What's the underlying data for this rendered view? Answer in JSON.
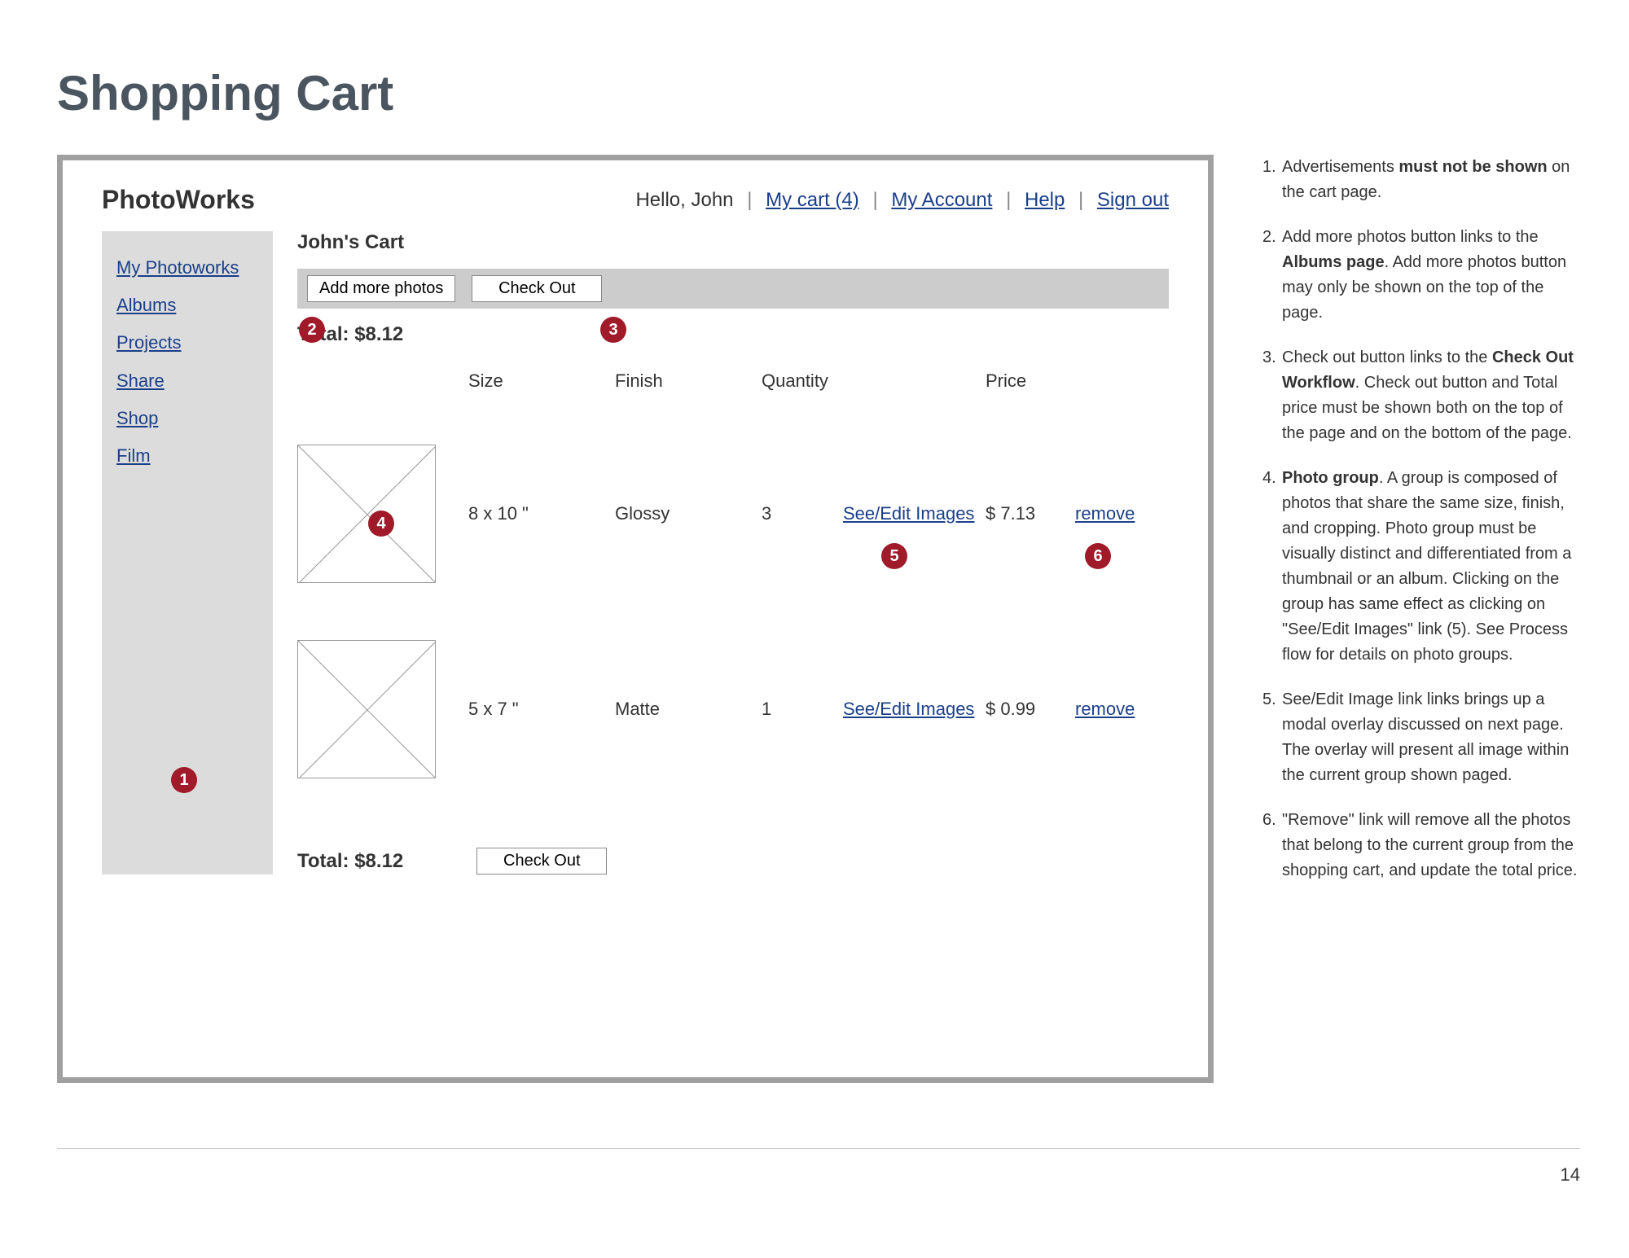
{
  "page_title": "Shopping Cart",
  "page_number": "14",
  "logo": "PhotoWorks",
  "greeting": "Hello, John",
  "top_links": {
    "cart": "My cart (4)",
    "account": "My Account",
    "help": "Help",
    "signout": "Sign out"
  },
  "sidebar": [
    "My Photoworks",
    "Albums",
    "Projects",
    "Share",
    "Shop",
    "Film"
  ],
  "cart_title": "John's Cart",
  "buttons": {
    "add_photos": "Add more photos",
    "checkout": "Check Out"
  },
  "total_label": "Total: $8.12",
  "headers": {
    "size": "Size",
    "finish": "Finish",
    "quantity": "Quantity",
    "price": "Price"
  },
  "see_edit_label": "See/Edit Images",
  "remove_label": "remove",
  "rows": [
    {
      "size": "8 x 10 \"",
      "finish": "Glossy",
      "qty": "3",
      "price": "$ 7.13"
    },
    {
      "size": "5 x 7 \"",
      "finish": "Matte",
      "qty": "1",
      "price": "$ 0.99"
    }
  ],
  "annotations": {
    "n1": {
      "num": "1.",
      "pre": "Advertisements ",
      "bold": "must not be shown",
      "post": " on the cart page."
    },
    "n2": {
      "num": "2.",
      "pre": "Add more photos button links to the ",
      "bold": "Albums page",
      "post": ". Add more photos button may only be shown on the top of the page."
    },
    "n3": {
      "num": "3.",
      "pre": "Check out button links to the ",
      "bold": "Check Out Workflow",
      "post": ". Check out button and Total price must be shown both on the top of the page and on the bottom of the page."
    },
    "n4": {
      "num": "4.",
      "bold": "Photo group",
      "post": ". A group is composed of photos that share the same size, finish, and cropping. Photo group must be visually distinct and differentiated from a thumbnail or an album. Clicking on the group has same effect as clicking on \"See/Edit Images\" link (5). See Process flow for details on photo groups."
    },
    "n5": {
      "num": "5.",
      "text": "See/Edit Image link links brings up a modal overlay discussed on next page. The overlay will present all image within the current group shown paged."
    },
    "n6": {
      "num": "6.",
      "text": "\"Remove\" link will remove all the photos that belong to the current group from the shopping cart, and update the total price."
    }
  },
  "markers": [
    "1",
    "2",
    "3",
    "4",
    "5",
    "6"
  ]
}
